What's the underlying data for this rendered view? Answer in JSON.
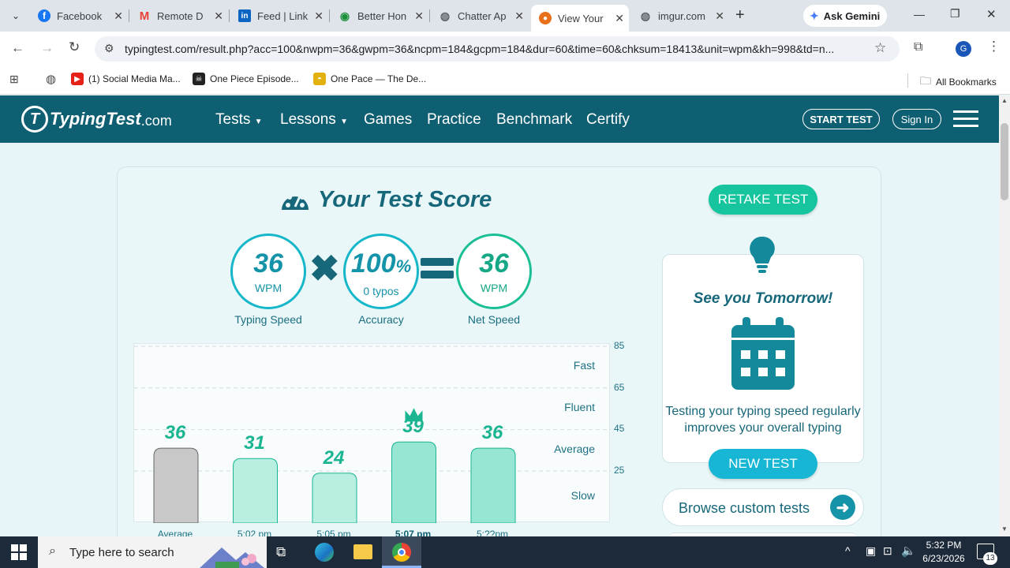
{
  "browser": {
    "tabs": [
      {
        "title": "Facebook",
        "icon": "facebook-icon"
      },
      {
        "title": "Remote D",
        "icon": "gmail-icon"
      },
      {
        "title": "Feed | Link",
        "icon": "linkedin-icon"
      },
      {
        "title": "Better Hon",
        "icon": "eye-icon"
      },
      {
        "title": "Chatter Ap",
        "icon": "globe-icon"
      },
      {
        "title": "View Your",
        "icon": "typingtest-icon"
      },
      {
        "title": "imgur.com",
        "icon": "globe-icon"
      }
    ],
    "ask_gemini": "Ask Gemini",
    "url": "typingtest.com/result.php?acc=100&nwpm=36&gwpm=36&ncpm=184&gcpm=184&dur=60&time=60&chksum=18413&unit=wpm&kh=998&td=n...",
    "profile_initial": "G",
    "bookmarks": [
      {
        "label": "(1) Social Media Ma..."
      },
      {
        "label": "One Piece Episode..."
      },
      {
        "label": "One Pace — The De..."
      }
    ],
    "all_bookmarks": "All Bookmarks"
  },
  "site": {
    "logo_main": "TypingTest",
    "logo_suffix": ".com",
    "nav": [
      "Tests",
      "Lessons",
      "Games",
      "Practice",
      "Benchmark",
      "Certify"
    ],
    "start_test": "START TEST",
    "sign_in": "Sign In"
  },
  "score": {
    "title": "Your Test Score",
    "typing_speed": {
      "value": "36",
      "unit": "WPM",
      "label": "Typing Speed"
    },
    "accuracy": {
      "value": "100",
      "unit_suffix": "%",
      "sub": "0 typos",
      "label": "Accuracy"
    },
    "net_speed": {
      "value": "36",
      "unit": "WPM",
      "label": "Net Speed"
    }
  },
  "chart_data": {
    "type": "bar",
    "categories": [
      "Average",
      "5:02 pm",
      "5:05 pm",
      "5:07 pm",
      "5:??pm"
    ],
    "values": [
      36,
      31,
      24,
      39,
      36
    ],
    "value_labels": [
      "36",
      "31",
      "24",
      "39",
      "36"
    ],
    "ylim": [
      0,
      85
    ],
    "yticks": [
      "85",
      "65",
      "45",
      "25"
    ],
    "zones": [
      "Fast",
      "Fluent",
      "Average",
      "Slow"
    ],
    "best_index": 3,
    "colors": {
      "average": "#c8c8c8",
      "bar": "#b9efe0",
      "best": "#97e6d4",
      "outline": "#1ab592"
    }
  },
  "panel": {
    "retake": "RETAKE TEST",
    "tip_title": "See you Tomorrow!",
    "tip_text": "Testing your typing speed regularly improves your overall typing",
    "new_test": "NEW TEST",
    "browse": "Browse custom tests"
  },
  "taskbar": {
    "search_placeholder": "Type here to search",
    "time": "5:32 PM",
    "date": "6/23/2026",
    "notifications": "13"
  }
}
